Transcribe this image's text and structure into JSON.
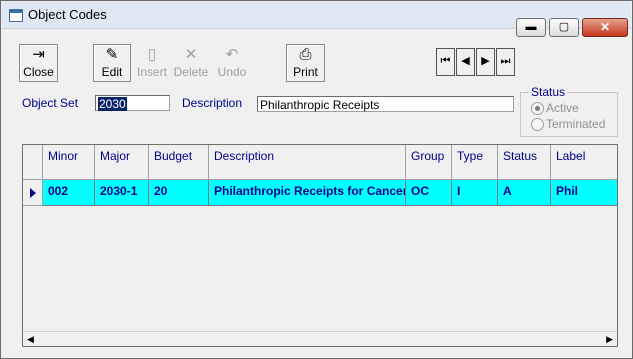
{
  "window": {
    "title": "Object Codes",
    "min_glyph": "▬",
    "max_glyph": "▢",
    "close_glyph": "✕"
  },
  "toolbar": {
    "close": {
      "label": "Close",
      "icon": "exit-door-icon",
      "glyph": "⇥"
    },
    "edit": {
      "label": "Edit",
      "icon": "pencil-icon",
      "glyph": "✎"
    },
    "insert": {
      "label": "Insert",
      "icon": "page-icon",
      "glyph": "▯"
    },
    "delete": {
      "label": "Delete",
      "icon": "x-icon",
      "glyph": "✕"
    },
    "undo": {
      "label": "Undo",
      "icon": "undo-icon",
      "glyph": "↶"
    },
    "print": {
      "label": "Print",
      "icon": "printer-icon",
      "glyph": "⎙"
    }
  },
  "navigation": {
    "first": {
      "glyph": "⏮",
      "icon": "first-record-icon"
    },
    "prev": {
      "glyph": "◀",
      "icon": "previous-record-icon"
    },
    "next": {
      "glyph": "▶",
      "icon": "next-record-icon"
    },
    "last": {
      "glyph": "⏭",
      "icon": "last-record-icon"
    }
  },
  "form": {
    "object_set_label": "Object Set",
    "object_set_value": "2030",
    "description_label": "Description",
    "description_value": "Philanthropic Receipts"
  },
  "status": {
    "legend": "Status",
    "options": [
      "Active",
      "Terminated"
    ],
    "selected": "Active"
  },
  "grid": {
    "columns": [
      "Minor",
      "Major",
      "Budget",
      "Description",
      "Group",
      "Type",
      "Status",
      "Label"
    ],
    "rows": [
      [
        "002",
        "2030-1",
        "20",
        "Philanthropic Receipts for Cancer",
        "OC",
        "I",
        "A",
        "Phil"
      ]
    ],
    "selected_row_color": "#00ffff"
  },
  "colors": {
    "label_blue": "#00008b",
    "selection_cyan": "#00ffff"
  }
}
